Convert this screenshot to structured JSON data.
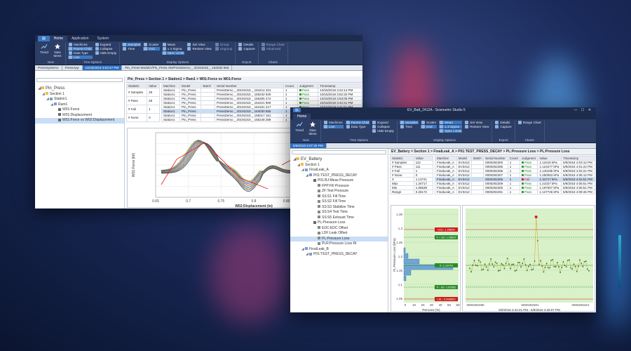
{
  "back_window": {
    "menu_tabs": [
      "Home",
      "Application",
      "System"
    ],
    "ribbon": {
      "new_group": {
        "label": "New",
        "items": [
          "Trend",
          "New Items"
        ]
      },
      "tree_options": {
        "label": "Tree Options",
        "items": [
          "Machines",
          "Parent-Child",
          "Data Type",
          "Line",
          "Expand",
          "Collapse",
          "Hide Empty"
        ]
      },
      "display_options": {
        "label": "Display Options",
        "items": [
          "Samples",
          "Time",
          "Scatter",
          "Grid",
          "Mean",
          "± 3 Sigma",
          "Spec Limits",
          "Set View",
          "Restore View",
          "Group",
          "Ungroup"
        ]
      },
      "export": {
        "label": "Export",
        "items": [
          "Details",
          "Capture"
        ]
      },
      "charts": {
        "label": "Charts",
        "items": [
          "Range Chart",
          "Advanced"
        ]
      }
    },
    "doc_tabs": [
      "PressSystem1",
      "PressApp",
      "10/15/2019 3:53:47 PM",
      "Pin_Press-ModelA/Pin_Press SN/PressDemo _ 20191015 _ 154030 555"
    ],
    "tree": [
      {
        "label": "Pin_Press",
        "level": 0
      },
      {
        "label": "Section 1",
        "level": 1
      },
      {
        "label": "Station1",
        "level": 2
      },
      {
        "label": "Ram1",
        "level": 3
      },
      {
        "label": "W01:Force",
        "level": 4
      },
      {
        "label": "W01:Displacement",
        "level": 4
      },
      {
        "label": "W01:Force vs W02:Displacement",
        "level": 4
      }
    ],
    "breadcrumb": "Pin_Press > Section 1 > Station1 > Ram1 > W01:Force vs W01:Force",
    "stats": {
      "headers": [
        "Statistic",
        "Value"
      ],
      "rows": [
        [
          "# Samples",
          "29"
        ],
        [
          "# Pass",
          "28"
        ],
        [
          "# Fail",
          "1"
        ],
        [
          "# None",
          "0"
        ]
      ]
    },
    "samples": {
      "headers": [
        "Machine",
        "Model",
        "Batch",
        "Serial Number",
        "Count",
        "Judgment",
        "Timestamp"
      ],
      "rows": [
        [
          "Station1",
          "Pin_Press",
          "",
          "PressDemo _ 20191015 _ 154214 331",
          "1",
          "Pass",
          "10/15/2019 3:42:14 PM"
        ],
        [
          "Station1",
          "Pin_Press",
          "",
          "PressDemo _ 20191015 _ 155232 930",
          "1",
          "Pass",
          "10/15/2019 3:52:32 PM"
        ],
        [
          "Station1",
          "Pin_Press",
          "",
          "PressDemo _ 20191015 _ 155305 474",
          "1",
          "Pass",
          "10/15/2019 3:53:05 PM"
        ],
        [
          "Station1",
          "Pin_Press",
          "",
          "PressDemo _ 20191015 _ 154221 969",
          "1",
          "Pass",
          "10/15/2019 3:42:21 PM"
        ],
        [
          "Station1",
          "Pin_Press",
          "",
          "PressDemo _ 20191015 _ 154151 217",
          "1",
          "Pass",
          "10/15/2019 3:41:51 PM"
        ],
        [
          "Station1",
          "Pin_Press",
          "",
          "PressDemo _ 20191015 _ 154030 555",
          "1",
          "Fail",
          "10/15/2019 3:40:30 PM"
        ],
        [
          "Station1",
          "Pin_Press",
          "",
          "PressDemo _ 20191015 _ 155017 161",
          "1",
          "Pass",
          "10/15/2019 3:50:17 PM"
        ],
        [
          "Station1",
          "Pin_Press",
          "",
          "PressDemo _ 20191015 _ 155248 289",
          "1",
          "Pass",
          "10/15/2019 3:52:48 PM"
        ]
      ]
    },
    "chart": {
      "xlabel": "W02:Displacement (in)",
      "ylabel": "W01:Force (lbf)",
      "xticks": [
        "0.65",
        "0.7",
        "0.75",
        "0.8",
        "0.85",
        "0.9",
        "0.95"
      ]
    }
  },
  "front_window": {
    "title": "EV_Batt_2412A - Sciemetric Studio 5",
    "menu_tabs": [
      "Home"
    ],
    "ribbon": {
      "new_group": {
        "label": "New",
        "items": [
          "Trend",
          "New Items"
        ]
      },
      "tree_options": {
        "label": "Tree Options",
        "items": [
          "Machines",
          "Parent-Child",
          "Data Type",
          "Line",
          "Expand",
          "Collapse",
          "Hide Empty"
        ]
      },
      "display_options": {
        "label": "Display Options",
        "items": [
          "Samples",
          "Time",
          "Scatter",
          "Grid",
          "Mean",
          "± 3 Sigma",
          "Spec Limits",
          "Set View",
          "Restore View"
        ]
      },
      "export": {
        "label": "Export",
        "items": [
          "Details",
          "Capture"
        ]
      },
      "charts": {
        "label": "Charts",
        "items": [
          "Range Chart"
        ]
      }
    },
    "doc_tabs": [
      "5/9/2018 3:07:25 PM"
    ],
    "tree": [
      {
        "label": "EV_Battery",
        "level": 0
      },
      {
        "label": "Section 1",
        "level": 1
      },
      {
        "label": "FinalLeak_A",
        "level": 2
      },
      {
        "label": "P01:TEST_PRESS_DECAY",
        "level": 3
      },
      {
        "label": "P01:BJ:Meas Pressure",
        "level": 4
      },
      {
        "label": "FPP:Fill Pressure",
        "level": 5
      },
      {
        "label": "ZF:Test Pressure",
        "level": 5
      },
      {
        "label": "SS:S1 Fill Time",
        "level": 5
      },
      {
        "label": "SS:S2 Fill Time",
        "level": 5
      },
      {
        "label": "SS:S3 Stabilize Time",
        "level": 5
      },
      {
        "label": "SS:S4 Test Time",
        "level": 5
      },
      {
        "label": "SS:S5 Exhaust Time",
        "level": 5
      },
      {
        "label": "PL:Pressure Loss",
        "level": 4
      },
      {
        "label": "EDC:EDC Offset",
        "level": 5
      },
      {
        "label": "LDF:Leak Offset",
        "level": 5
      },
      {
        "label": "PL:Pressure Loss",
        "level": 5,
        "selected": true
      },
      {
        "label": "PLR:Pressure Loss Rt",
        "level": 5
      },
      {
        "label": "FinalLeak_B",
        "level": 2
      },
      {
        "label": "P01:TEST_PRESS_DECAY",
        "level": 3
      }
    ],
    "breadcrumb": "EV_Battery > Section 1 > FinalLeak_A > P01:TEST_PRESS_DECAY > PL:Pressure Loss > PL:Pressure Loss",
    "stats": {
      "headers": [
        "Statistic",
        "Value"
      ],
      "rows": [
        [
          "# Samples",
          "112"
        ],
        [
          "# Pass",
          "111"
        ],
        [
          "# Fail",
          "1"
        ],
        [
          "# None",
          "0"
        ],
        [
          "X",
          "1.13741"
        ],
        [
          "Max",
          "1.34717"
        ],
        [
          "Min",
          "1.08538"
        ],
        [
          "Range",
          "0.26172"
        ]
      ]
    },
    "samples": {
      "headers": [
        "Machine",
        "Model",
        "Batch",
        "Serial Number",
        "Count",
        "Judgment",
        "Value",
        "Timestamp"
      ],
      "rows": [
        [
          "FinalLeak_A",
          "EV3412",
          "",
          "0000292300",
          "1",
          "Pass",
          "1.13415 kPa",
          "5/9/2018 4:03:12 PM"
        ],
        [
          "FinalLeak_A",
          "EV3412",
          "",
          "0000292285",
          "1",
          "Pass",
          "1.124277 kPa",
          "5/9/2018 4:01:22 PM"
        ],
        [
          "FinalLeak_A",
          "EV3412",
          "",
          "0000292286",
          "1",
          "Pass",
          "1.140195 kPa",
          "5/9/2018 4:02:21 PM"
        ],
        [
          "FinalLeak_A",
          "EV3412",
          "",
          "0000292307",
          "1",
          "Pass",
          "1.250053 kPa",
          "5/9/2018 4:05:12 PM"
        ],
        [
          "FinalLeak_A",
          "EV3412",
          "",
          "0000292306",
          "1",
          "Fail",
          "1.34717 kPa",
          "5/9/2018 4:04:51 PM"
        ],
        [
          "FinalLeak_A",
          "EV3412",
          "",
          "0000292309",
          "1",
          "Pass",
          "1.21027 kPa",
          "5/9/2018 4:05:51 PM"
        ],
        [
          "FinalLeak_A",
          "EV3412",
          "",
          "0000292300",
          "1",
          "Pass",
          "1.197007 kPa",
          "5/9/2018 4:05:51 PM"
        ],
        [
          "FinalLeak_A",
          "EV3412",
          "",
          "0000292291",
          "1",
          "Pass",
          "1.127726 kPa",
          "5/9/2018 4:08:46 PM"
        ]
      ]
    },
    "histogram": {
      "ylabel": "PL:Pressure Loss (kPa)",
      "xlabel": "Percent (%)",
      "yticks": [
        "1.35",
        "1.3",
        "1.25",
        "1.2",
        "1.15",
        "1.1",
        "1.05"
      ],
      "xticks": [
        "0",
        "10",
        "20",
        "30",
        "40",
        "50",
        "60"
      ],
      "usl_label": "USL: 1.26894",
      "lsl_label": "LSL: 0.998803",
      "plus3s_label": "X + 3σ: 1.25607",
      "mean_label": "X: 1.13741",
      "minus3s_label": "X - 3σ: 1.00562"
    },
    "trend": {
      "xticks": [
        "0000292285",
        "0000292301",
        "0000292321"
      ],
      "caption": "5/9/2018 3:44:21 PM - 5/9/2018 4:26:07 PM"
    }
  },
  "colors": {
    "ribbon": "#2c3e66",
    "titlebar": "#1d2b4d",
    "accent": "#2d6fc1",
    "usl": "#d21d1d",
    "mean": "#2e8b2e",
    "plot_bg": "#d8f1c9"
  }
}
